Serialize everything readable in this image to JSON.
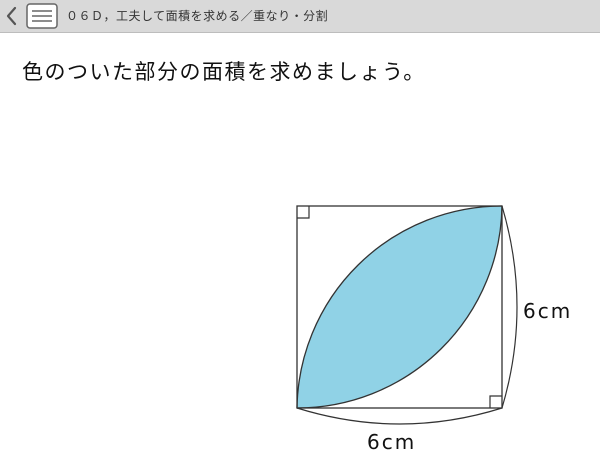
{
  "header": {
    "title": "０６Ｄ，工夫して面積を求める／重なり・分割",
    "back_icon": "chevron-left-icon",
    "menu_icon": "menu-list-icon"
  },
  "question": {
    "text": "色のついた部分の面積を求めましょう。"
  },
  "figure": {
    "side_label_right": "6cm",
    "side_label_bottom": "6cm",
    "shaded_fill": "#90d2e6",
    "stroke_color": "#333333"
  }
}
